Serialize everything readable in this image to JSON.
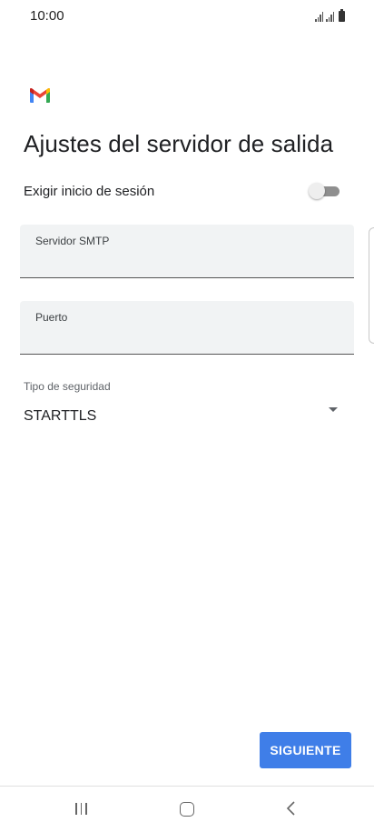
{
  "status_bar": {
    "time": "10:00"
  },
  "app": {
    "logo": "gmail-logo",
    "title": "Ajustes del servidor de salida"
  },
  "login_toggle": {
    "label": "Exigir inicio de sesión",
    "enabled": false
  },
  "fields": {
    "smtp": {
      "label": "Servidor SMTP",
      "value": ""
    },
    "port": {
      "label": "Puerto",
      "value": ""
    }
  },
  "security": {
    "label": "Tipo de seguridad",
    "value": "STARTTLS",
    "icon": "dropdown-arrow-icon"
  },
  "actions": {
    "next_label": "SIGUIENTE",
    "next_color": "#3f7ee8"
  },
  "nav_bar": {
    "icons": [
      "recents-icon",
      "home-icon",
      "back-icon"
    ]
  }
}
